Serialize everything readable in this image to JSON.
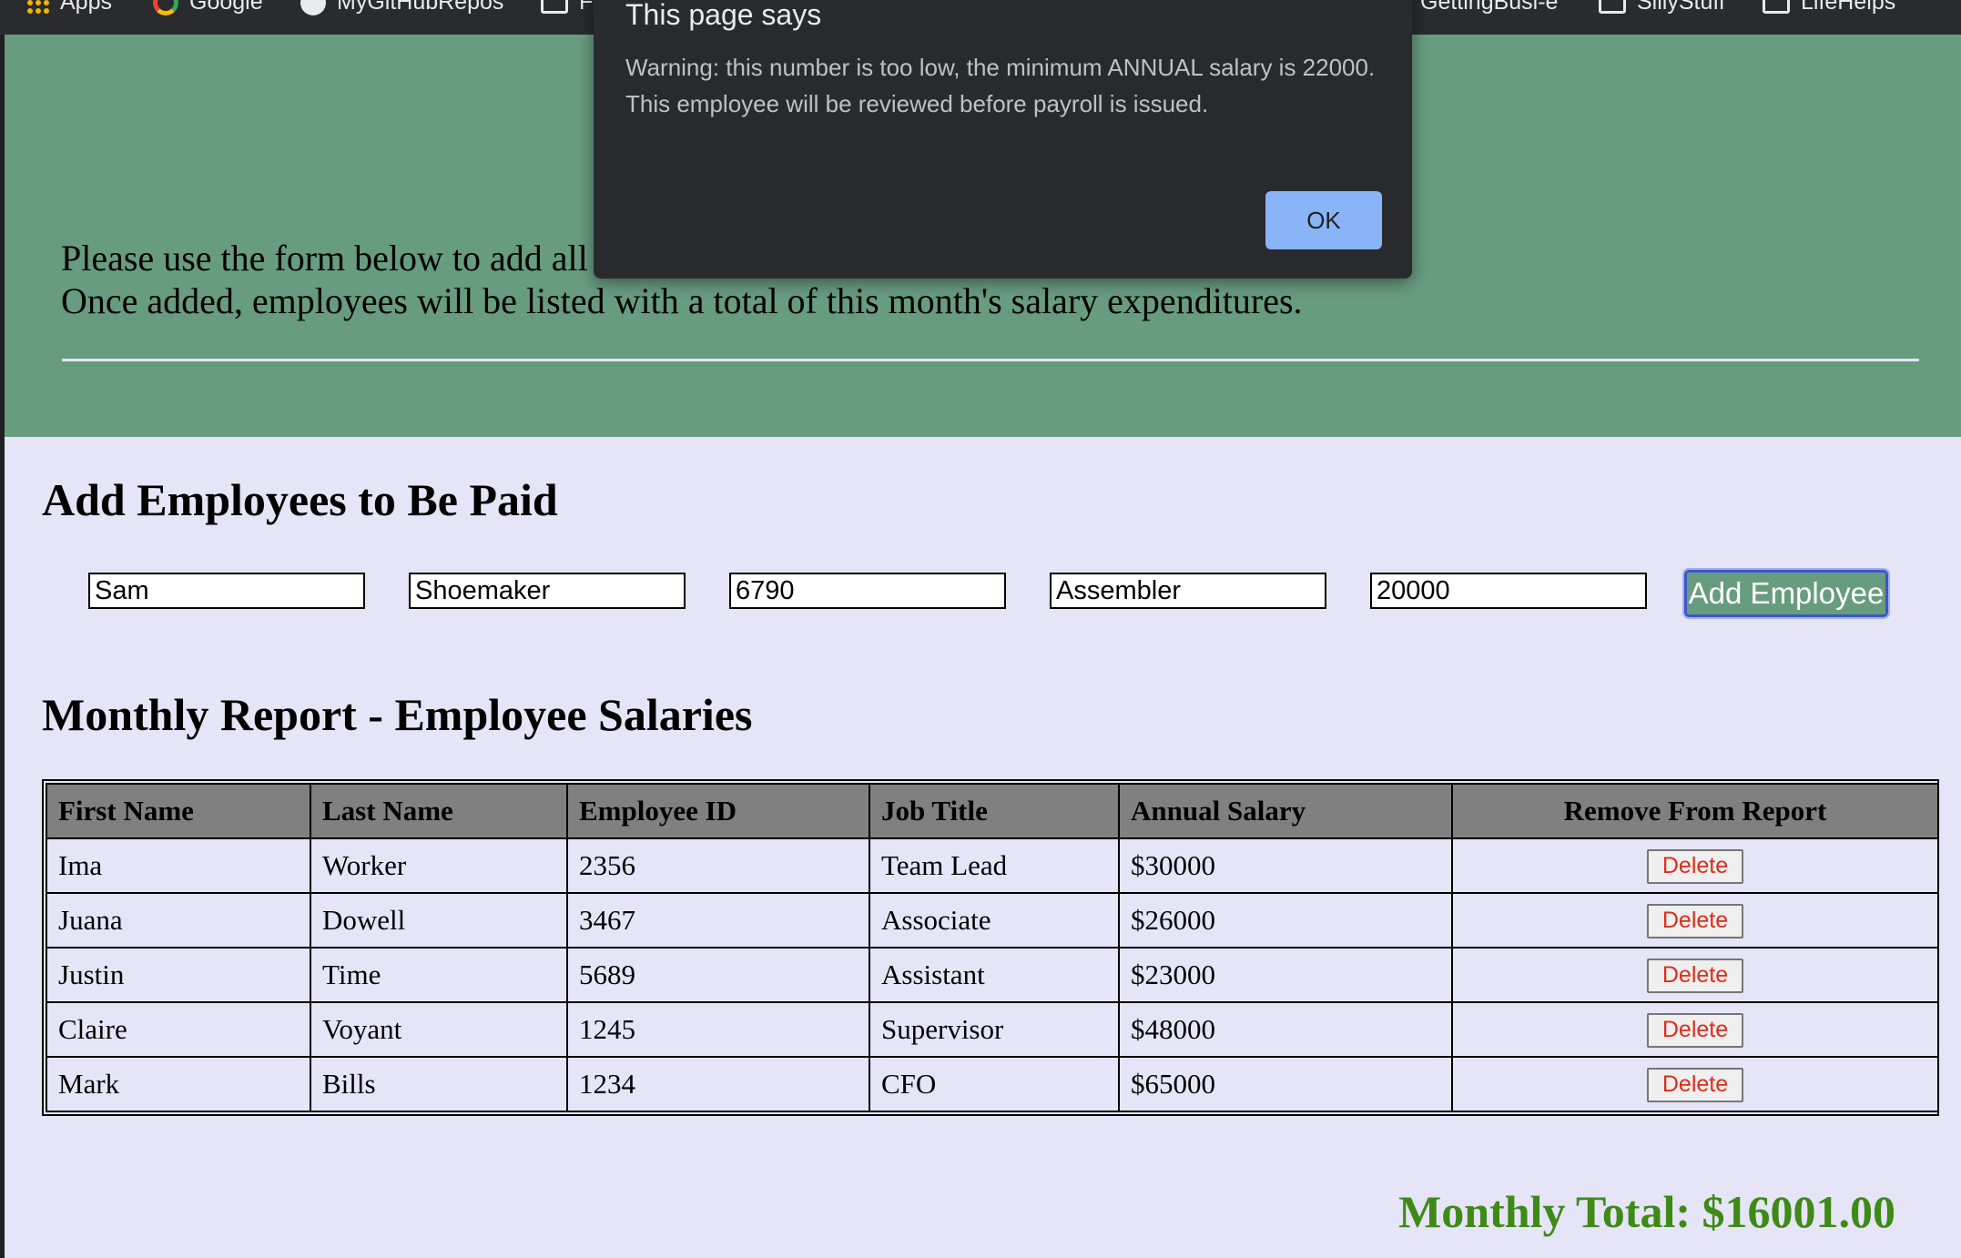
{
  "bookmarks": {
    "items": [
      {
        "label": "Apps",
        "icon": "apps-grid-icon"
      },
      {
        "label": "Google",
        "icon": "google-icon"
      },
      {
        "label": "MyGitHubRepos",
        "icon": "github-icon"
      },
      {
        "label": "F",
        "icon": "folder-icon"
      },
      {
        "label": "GettingBusi-e",
        "icon": "folder-icon"
      },
      {
        "label": "SillyStuff",
        "icon": "folder-icon"
      },
      {
        "label": "LifeHelps",
        "icon": "folder-icon"
      }
    ]
  },
  "header": {
    "intro_line1": "Please use the form below to add all",
    "intro_line2": "Once added, employees will be listed with a total of this month's salary expenditures."
  },
  "form": {
    "title": "Add Employees to Be Paid",
    "first_name": "Sam",
    "last_name": "Shoemaker",
    "employee_id": "6790",
    "job_title": "Assembler",
    "annual_salary": "20000",
    "submit_label": "Add Employee"
  },
  "report": {
    "title": "Monthly Report - Employee Salaries",
    "columns": [
      "First Name",
      "Last Name",
      "Employee ID",
      "Job Title",
      "Annual Salary",
      "Remove From Report"
    ],
    "rows": [
      {
        "first": "Ima",
        "last": "Worker",
        "id": "2356",
        "title": "Team Lead",
        "salary": "$30000",
        "action": "Delete"
      },
      {
        "first": "Juana",
        "last": "Dowell",
        "id": "3467",
        "title": "Associate",
        "salary": "$26000",
        "action": "Delete"
      },
      {
        "first": "Justin",
        "last": "Time",
        "id": "5689",
        "title": "Assistant",
        "salary": "$23000",
        "action": "Delete"
      },
      {
        "first": "Claire",
        "last": "Voyant",
        "id": "1245",
        "title": "Supervisor",
        "salary": "$48000",
        "action": "Delete"
      },
      {
        "first": "Mark",
        "last": "Bills",
        "id": "1234",
        "title": "CFO",
        "salary": "$65000",
        "action": "Delete"
      }
    ],
    "monthly_total": "Monthly Total: $16001.00"
  },
  "dialog": {
    "title": "This page says",
    "message": "Warning: this number is too low, the minimum ANNUAL salary is 22000. This employee will be reviewed before payroll is issued.",
    "ok_label": "OK"
  },
  "colors": {
    "header_bg": "#689c7f",
    "page_bg": "#e6e4f7",
    "total_text": "#3e8a16",
    "delete_text": "#e02b1a",
    "dialog_bg": "#292a2e",
    "ok_button": "#8ab4f8"
  }
}
